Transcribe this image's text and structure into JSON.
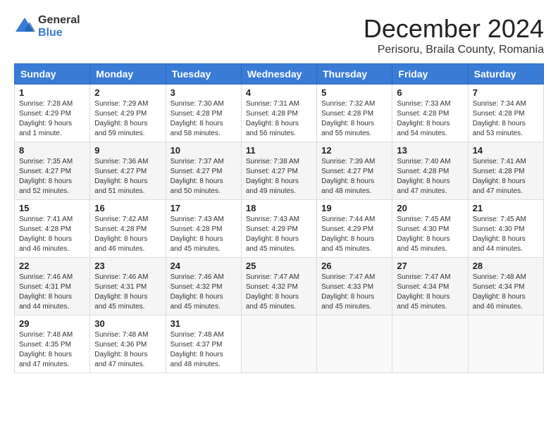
{
  "header": {
    "logo_general": "General",
    "logo_blue": "Blue",
    "month": "December 2024",
    "location": "Perisoru, Braila County, Romania"
  },
  "days_of_week": [
    "Sunday",
    "Monday",
    "Tuesday",
    "Wednesday",
    "Thursday",
    "Friday",
    "Saturday"
  ],
  "weeks": [
    [
      {
        "day": "1",
        "sunrise": "7:28 AM",
        "sunset": "4:29 PM",
        "daylight": "9 hours and 1 minute."
      },
      {
        "day": "2",
        "sunrise": "7:29 AM",
        "sunset": "4:29 PM",
        "daylight": "8 hours and 59 minutes."
      },
      {
        "day": "3",
        "sunrise": "7:30 AM",
        "sunset": "4:28 PM",
        "daylight": "8 hours and 58 minutes."
      },
      {
        "day": "4",
        "sunrise": "7:31 AM",
        "sunset": "4:28 PM",
        "daylight": "8 hours and 56 minutes."
      },
      {
        "day": "5",
        "sunrise": "7:32 AM",
        "sunset": "4:28 PM",
        "daylight": "8 hours and 55 minutes."
      },
      {
        "day": "6",
        "sunrise": "7:33 AM",
        "sunset": "4:28 PM",
        "daylight": "8 hours and 54 minutes."
      },
      {
        "day": "7",
        "sunrise": "7:34 AM",
        "sunset": "4:28 PM",
        "daylight": "8 hours and 53 minutes."
      }
    ],
    [
      {
        "day": "8",
        "sunrise": "7:35 AM",
        "sunset": "4:27 PM",
        "daylight": "8 hours and 52 minutes."
      },
      {
        "day": "9",
        "sunrise": "7:36 AM",
        "sunset": "4:27 PM",
        "daylight": "8 hours and 51 minutes."
      },
      {
        "day": "10",
        "sunrise": "7:37 AM",
        "sunset": "4:27 PM",
        "daylight": "8 hours and 50 minutes."
      },
      {
        "day": "11",
        "sunrise": "7:38 AM",
        "sunset": "4:27 PM",
        "daylight": "8 hours and 49 minutes."
      },
      {
        "day": "12",
        "sunrise": "7:39 AM",
        "sunset": "4:27 PM",
        "daylight": "8 hours and 48 minutes."
      },
      {
        "day": "13",
        "sunrise": "7:40 AM",
        "sunset": "4:28 PM",
        "daylight": "8 hours and 47 minutes."
      },
      {
        "day": "14",
        "sunrise": "7:41 AM",
        "sunset": "4:28 PM",
        "daylight": "8 hours and 47 minutes."
      }
    ],
    [
      {
        "day": "15",
        "sunrise": "7:41 AM",
        "sunset": "4:28 PM",
        "daylight": "8 hours and 46 minutes."
      },
      {
        "day": "16",
        "sunrise": "7:42 AM",
        "sunset": "4:28 PM",
        "daylight": "8 hours and 46 minutes."
      },
      {
        "day": "17",
        "sunrise": "7:43 AM",
        "sunset": "4:28 PM",
        "daylight": "8 hours and 45 minutes."
      },
      {
        "day": "18",
        "sunrise": "7:43 AM",
        "sunset": "4:29 PM",
        "daylight": "8 hours and 45 minutes."
      },
      {
        "day": "19",
        "sunrise": "7:44 AM",
        "sunset": "4:29 PM",
        "daylight": "8 hours and 45 minutes."
      },
      {
        "day": "20",
        "sunrise": "7:45 AM",
        "sunset": "4:30 PM",
        "daylight": "8 hours and 45 minutes."
      },
      {
        "day": "21",
        "sunrise": "7:45 AM",
        "sunset": "4:30 PM",
        "daylight": "8 hours and 44 minutes."
      }
    ],
    [
      {
        "day": "22",
        "sunrise": "7:46 AM",
        "sunset": "4:31 PM",
        "daylight": "8 hours and 44 minutes."
      },
      {
        "day": "23",
        "sunrise": "7:46 AM",
        "sunset": "4:31 PM",
        "daylight": "8 hours and 45 minutes."
      },
      {
        "day": "24",
        "sunrise": "7:46 AM",
        "sunset": "4:32 PM",
        "daylight": "8 hours and 45 minutes."
      },
      {
        "day": "25",
        "sunrise": "7:47 AM",
        "sunset": "4:32 PM",
        "daylight": "8 hours and 45 minutes."
      },
      {
        "day": "26",
        "sunrise": "7:47 AM",
        "sunset": "4:33 PM",
        "daylight": "8 hours and 45 minutes."
      },
      {
        "day": "27",
        "sunrise": "7:47 AM",
        "sunset": "4:34 PM",
        "daylight": "8 hours and 45 minutes."
      },
      {
        "day": "28",
        "sunrise": "7:48 AM",
        "sunset": "4:34 PM",
        "daylight": "8 hours and 46 minutes."
      }
    ],
    [
      {
        "day": "29",
        "sunrise": "7:48 AM",
        "sunset": "4:35 PM",
        "daylight": "8 hours and 47 minutes."
      },
      {
        "day": "30",
        "sunrise": "7:48 AM",
        "sunset": "4:36 PM",
        "daylight": "8 hours and 47 minutes."
      },
      {
        "day": "31",
        "sunrise": "7:48 AM",
        "sunset": "4:37 PM",
        "daylight": "8 hours and 48 minutes."
      },
      null,
      null,
      null,
      null
    ]
  ]
}
